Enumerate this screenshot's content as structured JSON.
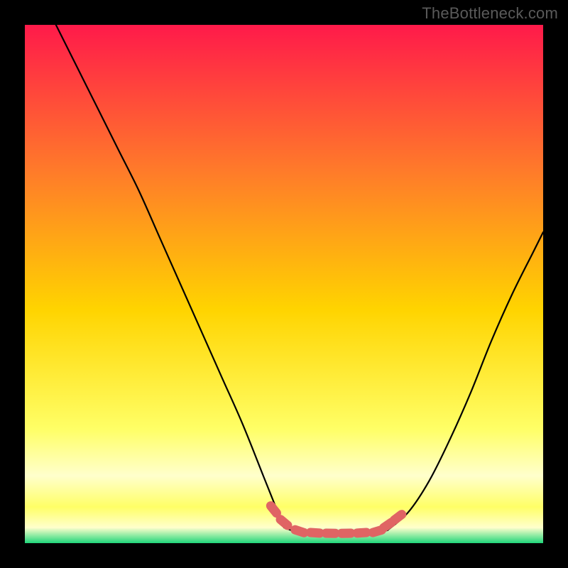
{
  "watermark": "TheBottleneck.com",
  "colors": {
    "frame": "#000000",
    "gradient_top": "#ff1a4a",
    "gradient_mid_upper": "#ff7a2a",
    "gradient_mid": "#ffd400",
    "gradient_mid_lower": "#ffff66",
    "gradient_band_pale": "#ffffcc",
    "gradient_bottom": "#1fd67a",
    "curve": "#000000",
    "marker_fill": "#e06464",
    "marker_stroke": "#7a2f2f"
  },
  "chart_data": {
    "type": "line",
    "title": "",
    "xlabel": "",
    "ylabel": "",
    "xlim": [
      0,
      100
    ],
    "ylim": [
      0,
      100
    ],
    "series": [
      {
        "name": "left-curve",
        "x": [
          6,
          10,
          14,
          18,
          22,
          26,
          30,
          34,
          38,
          42,
          46,
          48,
          50
        ],
        "y": [
          100,
          92,
          84,
          76,
          68,
          59,
          50,
          41,
          32,
          23,
          13,
          8,
          3
        ]
      },
      {
        "name": "valley-floor",
        "x": [
          50,
          53,
          56,
          59,
          62,
          65,
          68,
          70
        ],
        "y": [
          3,
          2,
          1.8,
          1.8,
          1.8,
          1.9,
          2.0,
          2.5
        ]
      },
      {
        "name": "right-curve",
        "x": [
          70,
          74,
          78,
          82,
          86,
          90,
          94,
          98,
          100
        ],
        "y": [
          2.5,
          6,
          12,
          20,
          29,
          39,
          48,
          56,
          60
        ]
      }
    ],
    "markers": {
      "name": "sweet-spot",
      "points": [
        {
          "x": 48,
          "y": 6.5
        },
        {
          "x": 50,
          "y": 4.0
        },
        {
          "x": 53,
          "y": 2.3
        },
        {
          "x": 56,
          "y": 2.0
        },
        {
          "x": 59,
          "y": 1.9
        },
        {
          "x": 62,
          "y": 1.9
        },
        {
          "x": 65,
          "y": 2.0
        },
        {
          "x": 68,
          "y": 2.3
        },
        {
          "x": 70,
          "y": 3.5
        },
        {
          "x": 72,
          "y": 5.0
        }
      ]
    }
  }
}
